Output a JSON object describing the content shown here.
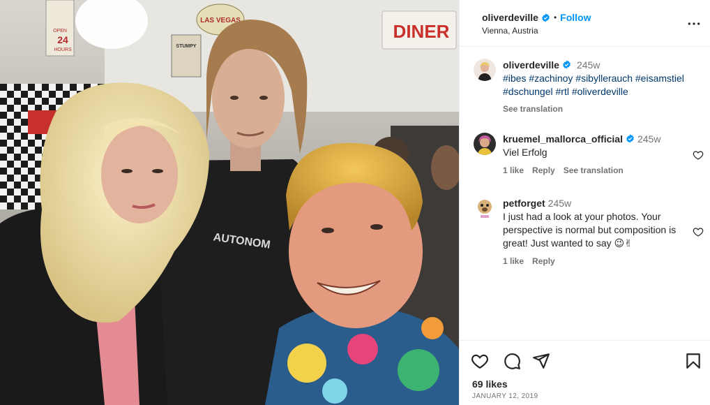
{
  "post": {
    "author": "oliverdeville",
    "follow_label": "Follow",
    "separator": "•",
    "location": "Vienna, Austria"
  },
  "photo": {
    "signs": {
      "las_vegas": "LAS VEGAS",
      "diner": "DINER",
      "open_hours": "24",
      "hours_label": "HOURS",
      "open_label": "OPEN",
      "stumpy": "STUMPY",
      "shirt_text": "AUTONOM"
    }
  },
  "caption": {
    "author": "oliverdeville",
    "time": "245w",
    "text": "#ibes #zachinoy #sibyllerauch #eisamstiel #dschungel #rtl #oliverdeville",
    "see_translation": "See translation"
  },
  "comments": [
    {
      "author": "kruemel_mallorca_official",
      "verified": true,
      "time": "245w",
      "text": "Viel Erfolg",
      "likes": "1 like",
      "reply": "Reply",
      "see_translation": "See translation"
    },
    {
      "author": "petforget",
      "verified": false,
      "time": "245w",
      "text": "I just had a look at your photos. Your perspective is normal but composition is great! Just wanted to say 😉✌",
      "likes": "1 like",
      "reply": "Reply"
    }
  ],
  "footer": {
    "likes": "69 likes",
    "date": "JANUARY 12, 2019"
  },
  "colors": {
    "accent": "#0095f6",
    "text": "#262626",
    "muted": "#737373",
    "hashtag": "#00376b",
    "border": "#efefef"
  },
  "icons": {
    "verified": "verified-badge-icon",
    "more": "more-options-icon",
    "like": "heart-icon",
    "comment": "comment-icon",
    "share": "share-icon",
    "save": "bookmark-icon"
  }
}
